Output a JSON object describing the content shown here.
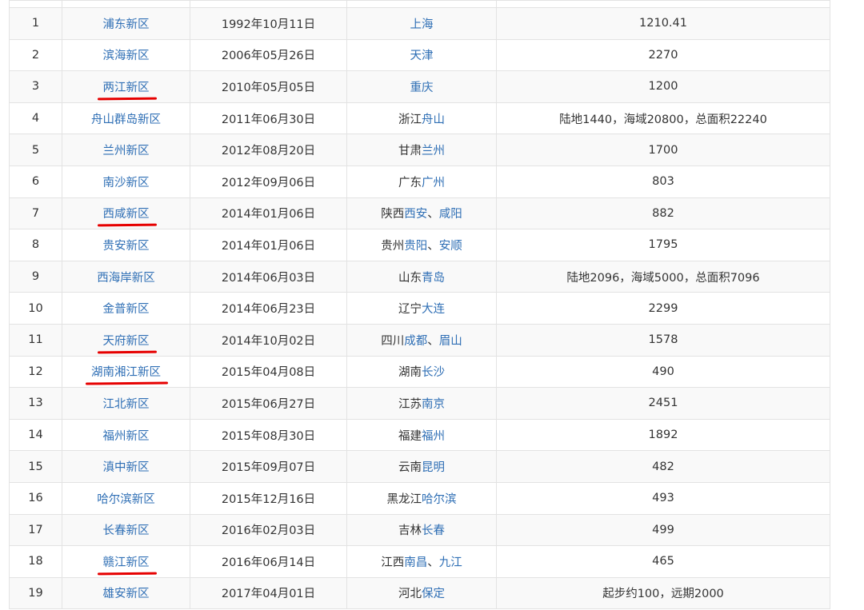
{
  "accent_colors": {
    "link": "#2f6fb5",
    "text": "#333333",
    "underline": "#e60000",
    "stripe": "#f9f9f9",
    "border": "#e3e3e3"
  },
  "rows": [
    {
      "no": "1",
      "name": "浦东新区",
      "date": "1992年10月11日",
      "loc_prefix": "",
      "loc_links": [
        "上海"
      ],
      "loc_sep": "",
      "area": "1210.41",
      "underlined": false
    },
    {
      "no": "2",
      "name": "滨海新区",
      "date": "2006年05月26日",
      "loc_prefix": "",
      "loc_links": [
        "天津"
      ],
      "loc_sep": "",
      "area": "2270",
      "underlined": false
    },
    {
      "no": "3",
      "name": "两江新区",
      "date": "2010年05月05日",
      "loc_prefix": "",
      "loc_links": [
        "重庆"
      ],
      "loc_sep": "",
      "area": "1200",
      "underlined": true
    },
    {
      "no": "4",
      "name": "舟山群岛新区",
      "date": "2011年06月30日",
      "loc_prefix": "浙江",
      "loc_links": [
        "舟山"
      ],
      "loc_sep": "",
      "area": "陆地1440，海域20800，总面积22240",
      "underlined": false
    },
    {
      "no": "5",
      "name": "兰州新区",
      "date": "2012年08月20日",
      "loc_prefix": "甘肃",
      "loc_links": [
        "兰州"
      ],
      "loc_sep": "",
      "area": "1700",
      "underlined": false
    },
    {
      "no": "6",
      "name": "南沙新区",
      "date": "2012年09月06日",
      "loc_prefix": "广东",
      "loc_links": [
        "广州"
      ],
      "loc_sep": "",
      "area": "803",
      "underlined": false
    },
    {
      "no": "7",
      "name": "西咸新区",
      "date": "2014年01月06日",
      "loc_prefix": "陕西",
      "loc_links": [
        "西安",
        "咸阳"
      ],
      "loc_sep": "、",
      "area": "882",
      "underlined": true
    },
    {
      "no": "8",
      "name": "贵安新区",
      "date": "2014年01月06日",
      "loc_prefix": "贵州",
      "loc_links": [
        "贵阳",
        "安顺"
      ],
      "loc_sep": "、",
      "area": "1795",
      "underlined": false
    },
    {
      "no": "9",
      "name": "西海岸新区",
      "date": "2014年06月03日",
      "loc_prefix": "山东",
      "loc_links": [
        "青岛"
      ],
      "loc_sep": "",
      "area": "陆地2096，海域5000，总面积7096",
      "underlined": false
    },
    {
      "no": "10",
      "name": "金普新区",
      "date": "2014年06月23日",
      "loc_prefix": "辽宁",
      "loc_links": [
        "大连"
      ],
      "loc_sep": "",
      "area": "2299",
      "underlined": false
    },
    {
      "no": "11",
      "name": "天府新区",
      "date": "2014年10月02日",
      "loc_prefix": "四川",
      "loc_links": [
        "成都",
        "眉山"
      ],
      "loc_sep": "、",
      "area": "1578",
      "underlined": true
    },
    {
      "no": "12",
      "name": "湖南湘江新区",
      "date": "2015年04月08日",
      "loc_prefix": "湖南",
      "loc_links": [
        "长沙"
      ],
      "loc_sep": "",
      "area": "490",
      "underlined": true
    },
    {
      "no": "13",
      "name": "江北新区",
      "date": "2015年06月27日",
      "loc_prefix": "江苏",
      "loc_links": [
        "南京"
      ],
      "loc_sep": "",
      "area": "2451",
      "underlined": false
    },
    {
      "no": "14",
      "name": "福州新区",
      "date": "2015年08月30日",
      "loc_prefix": "福建",
      "loc_links": [
        "福州"
      ],
      "loc_sep": "",
      "area": "1892",
      "underlined": false
    },
    {
      "no": "15",
      "name": "滇中新区",
      "date": "2015年09月07日",
      "loc_prefix": "云南",
      "loc_links": [
        "昆明"
      ],
      "loc_sep": "",
      "area": "482",
      "underlined": false
    },
    {
      "no": "16",
      "name": "哈尔滨新区",
      "date": "2015年12月16日",
      "loc_prefix": "黑龙江",
      "loc_links": [
        "哈尔滨"
      ],
      "loc_sep": "",
      "area": "493",
      "underlined": false
    },
    {
      "no": "17",
      "name": "长春新区",
      "date": "2016年02月03日",
      "loc_prefix": "吉林",
      "loc_links": [
        "长春"
      ],
      "loc_sep": "",
      "area": "499",
      "underlined": false
    },
    {
      "no": "18",
      "name": "赣江新区",
      "date": "2016年06月14日",
      "loc_prefix": "江西",
      "loc_links": [
        "南昌",
        "九江"
      ],
      "loc_sep": "、",
      "area": "465",
      "underlined": true
    },
    {
      "no": "19",
      "name": "雄安新区",
      "date": "2017年04月01日",
      "loc_prefix": "河北",
      "loc_links": [
        "保定"
      ],
      "loc_sep": "",
      "area": "起步约100，远期2000",
      "underlined": false
    }
  ]
}
